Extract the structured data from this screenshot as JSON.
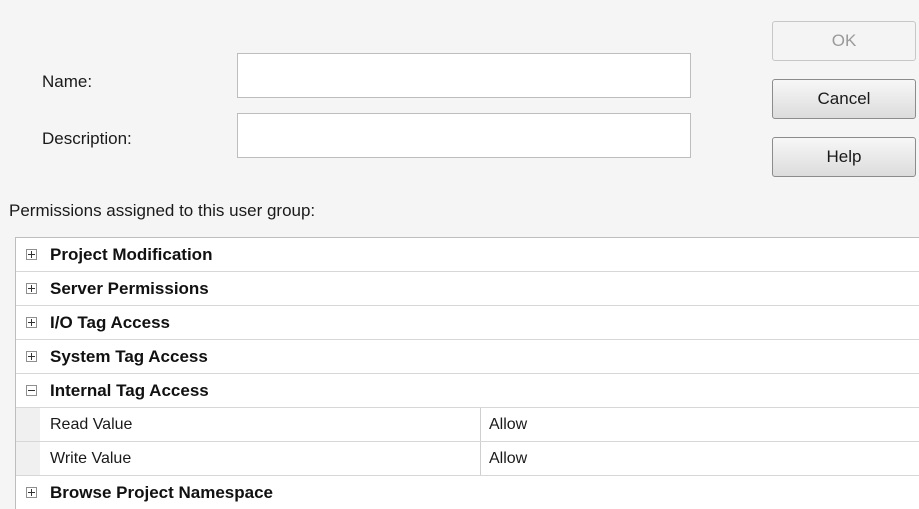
{
  "form": {
    "name_label": "Name:",
    "name_value": "",
    "description_label": "Description:",
    "description_value": ""
  },
  "buttons": {
    "ok": "OK",
    "cancel": "Cancel",
    "help": "Help"
  },
  "permissions": {
    "heading": "Permissions assigned to this user group:",
    "categories": [
      {
        "label": "Project Modification",
        "expanded": false
      },
      {
        "label": "Server Permissions",
        "expanded": false
      },
      {
        "label": "I/O Tag Access",
        "expanded": false
      },
      {
        "label": "System Tag Access",
        "expanded": false
      },
      {
        "label": "Internal Tag Access",
        "expanded": true,
        "properties": [
          {
            "name": "Read Value",
            "value": "Allow"
          },
          {
            "name": "Write Value",
            "value": "Allow"
          }
        ]
      },
      {
        "label": "Browse Project Namespace",
        "expanded": false
      }
    ]
  },
  "icons": {
    "expand": "plus-expander-icon",
    "collapse": "minus-expander-icon"
  }
}
